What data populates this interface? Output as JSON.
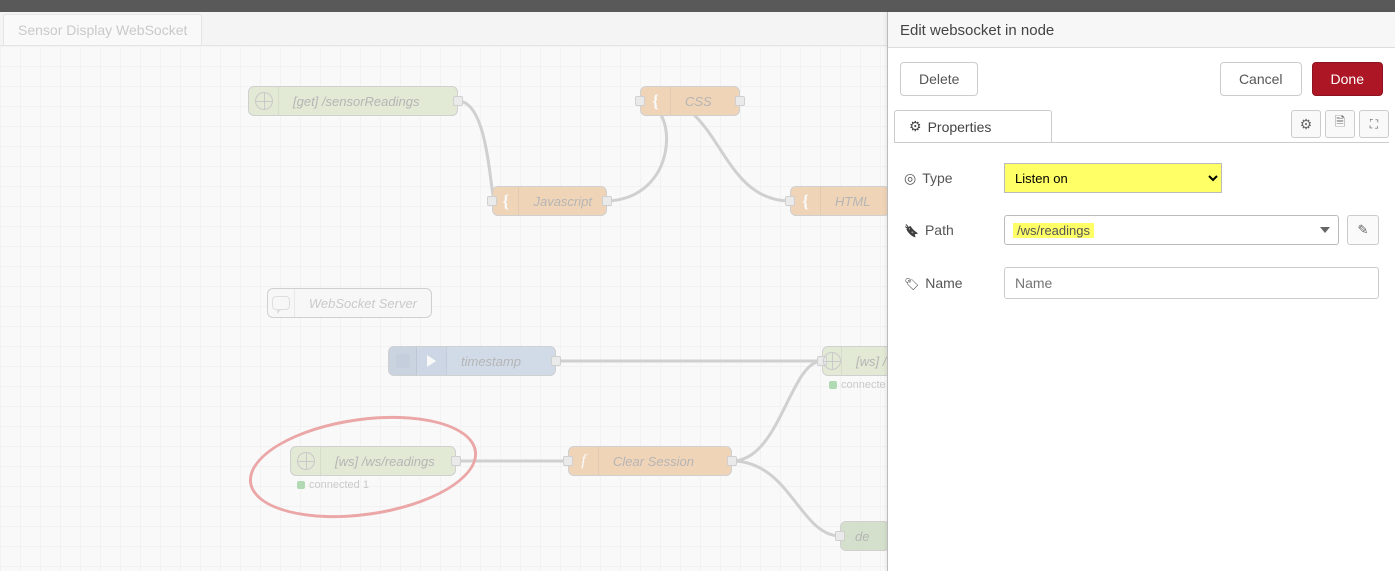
{
  "workspace": {
    "tab": "Sensor Display WebSocket",
    "nodes": {
      "httpin": {
        "label": "[get] /sensorReadings"
      },
      "css": {
        "label": "CSS"
      },
      "js": {
        "label": "Javascript"
      },
      "html": {
        "label": "HTML"
      },
      "comment": {
        "label": "WebSocket Server"
      },
      "inject": {
        "label": "timestamp"
      },
      "wsout": {
        "label": "[ws] /",
        "status": "connecte"
      },
      "wsin": {
        "label": "[ws] /ws/readings",
        "status": "connected 1"
      },
      "clear": {
        "label": "Clear Session"
      },
      "debug": {
        "label": "de"
      }
    }
  },
  "panel": {
    "title": "Edit websocket in node",
    "delete": "Delete",
    "cancel": "Cancel",
    "done": "Done",
    "properties_tab": "Properties",
    "form": {
      "type_label": "Type",
      "type_value": "Listen on",
      "path_label": "Path",
      "path_value": "/ws/readings",
      "name_label": "Name",
      "name_placeholder": "Name",
      "name_value": ""
    }
  }
}
